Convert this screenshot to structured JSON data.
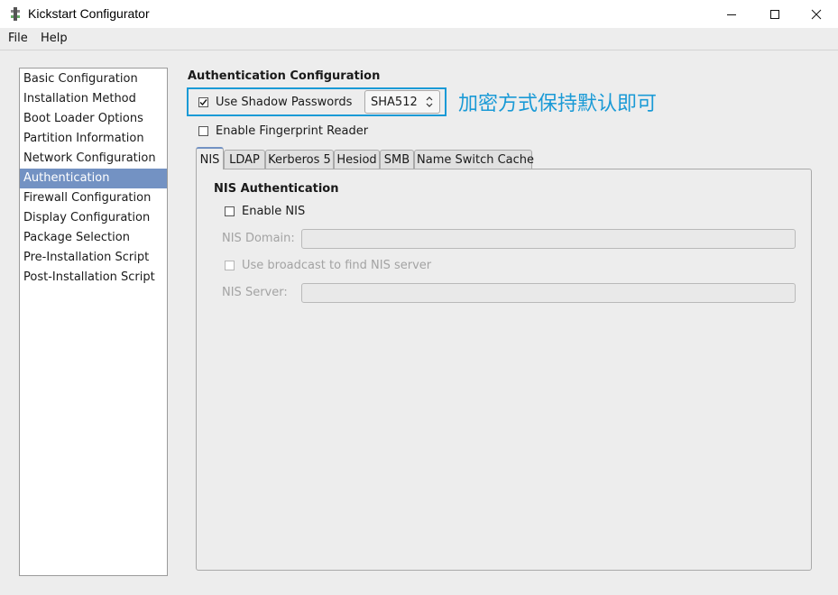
{
  "window": {
    "title": "Kickstart Configurator"
  },
  "menu": {
    "file": "File",
    "help": "Help"
  },
  "sidebar": {
    "items": [
      {
        "label": "Basic Configuration"
      },
      {
        "label": "Installation Method"
      },
      {
        "label": "Boot Loader Options"
      },
      {
        "label": "Partition Information"
      },
      {
        "label": "Network Configuration"
      },
      {
        "label": "Authentication"
      },
      {
        "label": "Firewall Configuration"
      },
      {
        "label": "Display Configuration"
      },
      {
        "label": "Package Selection"
      },
      {
        "label": "Pre-Installation Script"
      },
      {
        "label": "Post-Installation Script"
      }
    ],
    "selected": "Authentication"
  },
  "auth": {
    "title": "Authentication Configuration",
    "shadow_label": "Use Shadow Passwords",
    "shadow_checked": true,
    "hash_value": "SHA512",
    "annotation": "加密方式保持默认即可",
    "fingerprint_label": "Enable Fingerprint Reader",
    "fingerprint_checked": false
  },
  "tabs": [
    {
      "label": "NIS",
      "active": true
    },
    {
      "label": "LDAP"
    },
    {
      "label": "Kerberos 5"
    },
    {
      "label": "Hesiod"
    },
    {
      "label": "SMB"
    },
    {
      "label": "Name Switch Cache"
    }
  ],
  "nis": {
    "heading": "NIS Authentication",
    "enable_label": "Enable NIS",
    "enable_checked": false,
    "domain_label": "NIS Domain:",
    "domain_value": "",
    "broadcast_label": "Use broadcast to find NIS server",
    "broadcast_checked": false,
    "server_label": "NIS Server:",
    "server_value": ""
  },
  "colors": {
    "selection": "#7392c3",
    "annotation": "#1a9ad6"
  }
}
